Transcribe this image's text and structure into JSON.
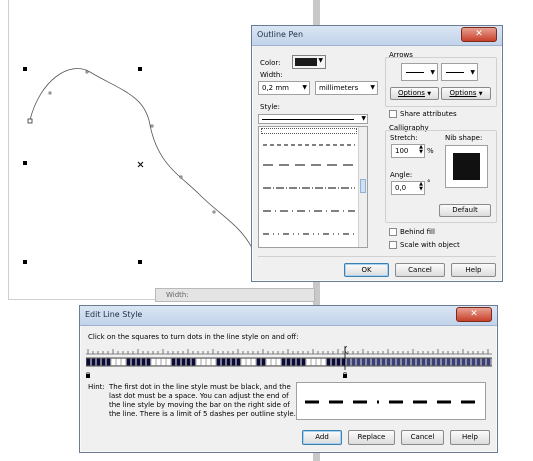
{
  "outline_pen": {
    "title": "Outline Pen",
    "close_glyph": "✕",
    "color_label": "Color:",
    "color_value": "#1a1a1a",
    "width_label": "Width:",
    "width_value": "0,2 mm",
    "units_value": "millimeters",
    "style_label": "Style:",
    "arrows_label": "Arrows",
    "options_left": "Options",
    "options_right": "Options",
    "share_attributes": "Share attributes",
    "calligraphy_label": "Calligraphy",
    "stretch_label": "Stretch:",
    "stretch_value": "100",
    "percent": "%",
    "nib_shape_label": "Nib shape:",
    "angle_label": "Angle:",
    "angle_value": "0,0",
    "degree": "°",
    "default_button": "Default",
    "behind_fill": "Behind fill",
    "scale_with_object": "Scale with object",
    "ok": "OK",
    "cancel": "Cancel",
    "help": "Help"
  },
  "edit_line_style": {
    "title": "Edit Line Style",
    "close_glyph": "✕",
    "instruction": "Click on the squares to turn dots in the line style on and off:",
    "hint_label": "Hint:",
    "hint_line1": "The first dot in the line style must be black, and the",
    "hint_line2": "last dot must be a space. You can adjust the end of",
    "hint_line3": "the line style by moving the bar on the right side of",
    "hint_line4": "the line. There is a limit of 5 dashes per outline style.",
    "add": "Add",
    "replace": "Replace",
    "cancel": "Cancel",
    "help": "Help"
  },
  "background_fragment": "Width:"
}
